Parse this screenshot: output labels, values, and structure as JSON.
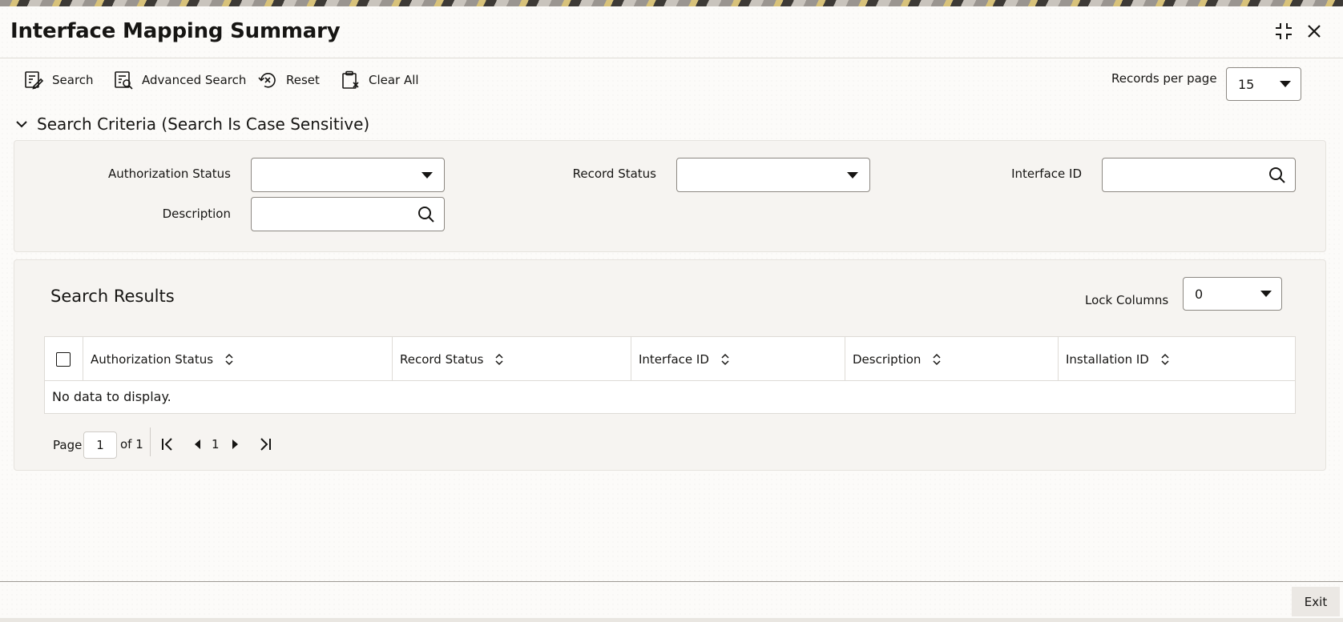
{
  "window": {
    "title": "Interface Mapping Summary"
  },
  "toolbar": {
    "search_label": "Search",
    "advanced_search_label": "Advanced Search",
    "reset_label": "Reset",
    "clear_all_label": "Clear All",
    "records_per_page_label": "Records per page",
    "records_per_page_value": "15"
  },
  "criteria": {
    "header": "Search Criteria (Search Is Case Sensitive)",
    "fields": {
      "authorization_status_label": "Authorization Status",
      "authorization_status_value": "",
      "record_status_label": "Record Status",
      "record_status_value": "",
      "interface_id_label": "Interface ID",
      "interface_id_value": "",
      "description_label": "Description",
      "description_value": ""
    }
  },
  "results": {
    "title": "Search Results",
    "lock_columns_label": "Lock Columns",
    "lock_columns_value": "0",
    "columns": [
      "Authorization Status",
      "Record Status",
      "Interface ID",
      "Description",
      "Installation ID"
    ],
    "empty_message": "No data to display."
  },
  "pagination": {
    "page_label": "Page",
    "current_page": "1",
    "of_label": "of 1",
    "nav_page": "1"
  },
  "footer": {
    "exit_label": "Exit"
  }
}
